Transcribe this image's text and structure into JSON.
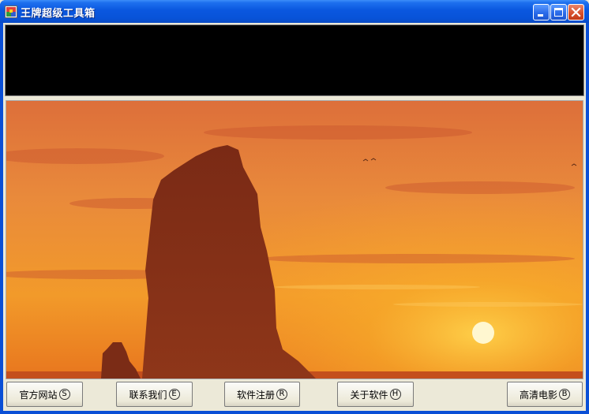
{
  "window": {
    "title": "王牌超级工具箱",
    "controls": {
      "minimize": "minimize",
      "maximize": "maximize",
      "close": "close"
    }
  },
  "colors": {
    "titlebar": "#0a57df",
    "banner": "#000000",
    "sky_top": "#e0773a",
    "sky_bottom": "#f7a21a",
    "sun": "#fff6c8"
  },
  "buttons": [
    {
      "label": "官方网站",
      "hotkey": "S"
    },
    {
      "label": "联系我们",
      "hotkey": "E"
    },
    {
      "label": "软件注册",
      "hotkey": "R"
    },
    {
      "label": "关于软件",
      "hotkey": "H"
    },
    {
      "label": "高清电影",
      "hotkey": "B"
    }
  ],
  "icons": [
    "app-icon",
    "minimize-icon",
    "maximize-icon",
    "close-icon"
  ]
}
